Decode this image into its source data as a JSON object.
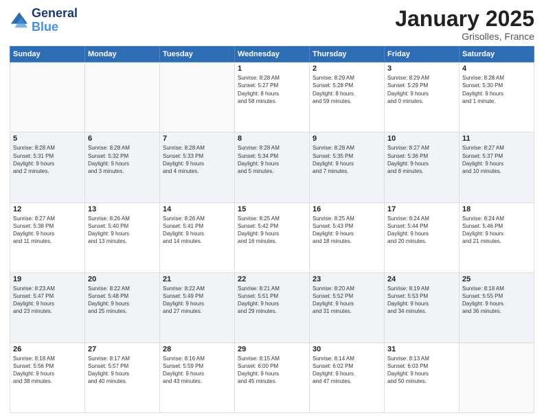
{
  "logo": {
    "line1": "General",
    "line2": "Blue"
  },
  "header": {
    "month": "January 2025",
    "location": "Grisolles, France"
  },
  "days_of_week": [
    "Sunday",
    "Monday",
    "Tuesday",
    "Wednesday",
    "Thursday",
    "Friday",
    "Saturday"
  ],
  "weeks": [
    [
      {
        "day": "",
        "data": ""
      },
      {
        "day": "",
        "data": ""
      },
      {
        "day": "",
        "data": ""
      },
      {
        "day": "1",
        "data": "Sunrise: 8:28 AM\nSunset: 5:27 PM\nDaylight: 8 hours\nand 58 minutes."
      },
      {
        "day": "2",
        "data": "Sunrise: 8:29 AM\nSunset: 5:28 PM\nDaylight: 8 hours\nand 59 minutes."
      },
      {
        "day": "3",
        "data": "Sunrise: 8:29 AM\nSunset: 5:29 PM\nDaylight: 9 hours\nand 0 minutes."
      },
      {
        "day": "4",
        "data": "Sunrise: 8:28 AM\nSunset: 5:30 PM\nDaylight: 9 hours\nand 1 minute."
      }
    ],
    [
      {
        "day": "5",
        "data": "Sunrise: 8:28 AM\nSunset: 5:31 PM\nDaylight: 9 hours\nand 2 minutes."
      },
      {
        "day": "6",
        "data": "Sunrise: 8:28 AM\nSunset: 5:32 PM\nDaylight: 9 hours\nand 3 minutes."
      },
      {
        "day": "7",
        "data": "Sunrise: 8:28 AM\nSunset: 5:33 PM\nDaylight: 9 hours\nand 4 minutes."
      },
      {
        "day": "8",
        "data": "Sunrise: 8:28 AM\nSunset: 5:34 PM\nDaylight: 9 hours\nand 5 minutes."
      },
      {
        "day": "9",
        "data": "Sunrise: 8:28 AM\nSunset: 5:35 PM\nDaylight: 9 hours\nand 7 minutes."
      },
      {
        "day": "10",
        "data": "Sunrise: 8:27 AM\nSunset: 5:36 PM\nDaylight: 9 hours\nand 8 minutes."
      },
      {
        "day": "11",
        "data": "Sunrise: 8:27 AM\nSunset: 5:37 PM\nDaylight: 9 hours\nand 10 minutes."
      }
    ],
    [
      {
        "day": "12",
        "data": "Sunrise: 8:27 AM\nSunset: 5:38 PM\nDaylight: 9 hours\nand 11 minutes."
      },
      {
        "day": "13",
        "data": "Sunrise: 8:26 AM\nSunset: 5:40 PM\nDaylight: 9 hours\nand 13 minutes."
      },
      {
        "day": "14",
        "data": "Sunrise: 8:26 AM\nSunset: 5:41 PM\nDaylight: 9 hours\nand 14 minutes."
      },
      {
        "day": "15",
        "data": "Sunrise: 8:25 AM\nSunset: 5:42 PM\nDaylight: 9 hours\nand 16 minutes."
      },
      {
        "day": "16",
        "data": "Sunrise: 8:25 AM\nSunset: 5:43 PM\nDaylight: 9 hours\nand 18 minutes."
      },
      {
        "day": "17",
        "data": "Sunrise: 8:24 AM\nSunset: 5:44 PM\nDaylight: 9 hours\nand 20 minutes."
      },
      {
        "day": "18",
        "data": "Sunrise: 8:24 AM\nSunset: 5:46 PM\nDaylight: 9 hours\nand 21 minutes."
      }
    ],
    [
      {
        "day": "19",
        "data": "Sunrise: 8:23 AM\nSunset: 5:47 PM\nDaylight: 9 hours\nand 23 minutes."
      },
      {
        "day": "20",
        "data": "Sunrise: 8:22 AM\nSunset: 5:48 PM\nDaylight: 9 hours\nand 25 minutes."
      },
      {
        "day": "21",
        "data": "Sunrise: 8:22 AM\nSunset: 5:49 PM\nDaylight: 9 hours\nand 27 minutes."
      },
      {
        "day": "22",
        "data": "Sunrise: 8:21 AM\nSunset: 5:51 PM\nDaylight: 9 hours\nand 29 minutes."
      },
      {
        "day": "23",
        "data": "Sunrise: 8:20 AM\nSunset: 5:52 PM\nDaylight: 9 hours\nand 31 minutes."
      },
      {
        "day": "24",
        "data": "Sunrise: 8:19 AM\nSunset: 5:53 PM\nDaylight: 9 hours\nand 34 minutes."
      },
      {
        "day": "25",
        "data": "Sunrise: 8:18 AM\nSunset: 5:55 PM\nDaylight: 9 hours\nand 36 minutes."
      }
    ],
    [
      {
        "day": "26",
        "data": "Sunrise: 8:18 AM\nSunset: 5:56 PM\nDaylight: 9 hours\nand 38 minutes."
      },
      {
        "day": "27",
        "data": "Sunrise: 8:17 AM\nSunset: 5:57 PM\nDaylight: 9 hours\nand 40 minutes."
      },
      {
        "day": "28",
        "data": "Sunrise: 8:16 AM\nSunset: 5:59 PM\nDaylight: 9 hours\nand 43 minutes."
      },
      {
        "day": "29",
        "data": "Sunrise: 8:15 AM\nSunset: 6:00 PM\nDaylight: 9 hours\nand 45 minutes."
      },
      {
        "day": "30",
        "data": "Sunrise: 8:14 AM\nSunset: 6:02 PM\nDaylight: 9 hours\nand 47 minutes."
      },
      {
        "day": "31",
        "data": "Sunrise: 8:13 AM\nSunset: 6:03 PM\nDaylight: 9 hours\nand 50 minutes."
      },
      {
        "day": "",
        "data": ""
      }
    ]
  ]
}
